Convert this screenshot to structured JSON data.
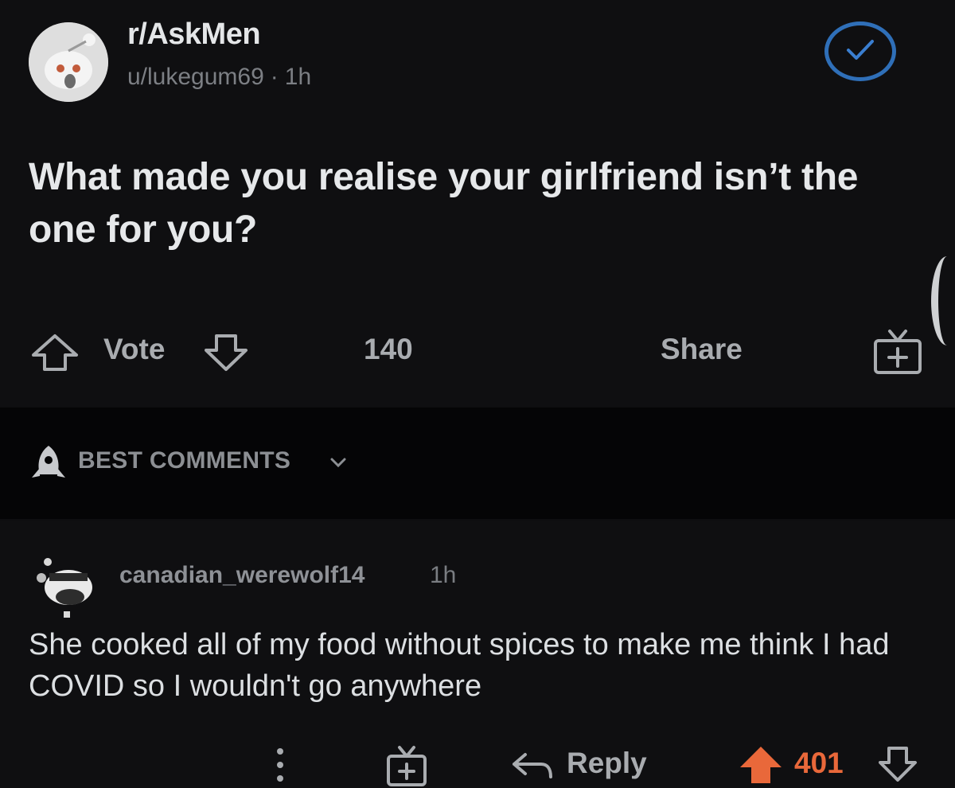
{
  "post": {
    "subreddit": "r/AskMen",
    "author": "u/lukegum69",
    "separator": "·",
    "age": "1h",
    "title": "What made you realise your girlfriend isn’t the one for you?",
    "joined_icon": "check-circle-icon",
    "actions": {
      "vote_label": "Vote",
      "comment_count": "140",
      "share_label": "Share",
      "award_icon": "gift-plus-icon"
    }
  },
  "sort": {
    "label": "BEST COMMENTS",
    "icon": "rocket-icon",
    "chevron": "chevron-down-icon"
  },
  "comment": {
    "author": "canadian_werewolf14",
    "age": "1h",
    "body": "She cooked all of my food without spices to make me think I had COVID so I wouldn't go anywhere",
    "actions": {
      "more_icon": "more-vertical-icon",
      "award_icon": "gift-plus-icon",
      "reply_label": "Reply",
      "score": "401"
    }
  },
  "colors": {
    "background": "#0f0f11",
    "sort_bar": "#050506",
    "upvote_active": "#e9683a",
    "joined_ring": "#2f6fb8"
  }
}
